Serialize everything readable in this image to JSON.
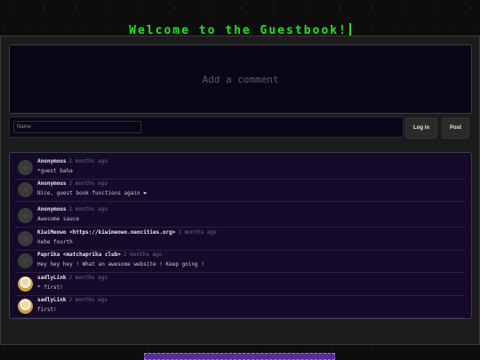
{
  "header": {
    "title": "Welcome to the Guestbook!"
  },
  "form": {
    "comment_placeholder": "Add a comment",
    "name_placeholder": "Name",
    "login_label": "Log in",
    "post_label": "Post"
  },
  "comments": [
    {
      "author": "Anonymous",
      "time": "2 months ago",
      "text": "*guest baha",
      "avatar": "default"
    },
    {
      "author": "Anonymous",
      "time": "2 months ago",
      "text": "Nice, guest book functions again ❤",
      "avatar": "default"
    },
    {
      "author": "Anonymous",
      "time": "2 months ago",
      "text": "Awesome sauce",
      "avatar": "default"
    },
    {
      "author": "KiwiMeowo <https://kiwimeowo.neocities.org>",
      "time": "2 months ago",
      "text": "hehe fourth",
      "avatar": "default"
    },
    {
      "author": "Paprika <matchaprika club>",
      "time": "2 months ago",
      "text": "Hey hey hey ! What an awesome website ! Keep going !",
      "avatar": "default"
    },
    {
      "author": "sadlyLink",
      "time": "2 months ago",
      "text": "* first!",
      "avatar": "image"
    },
    {
      "author": "sadlyLink",
      "time": "2 months ago",
      "text": "first!",
      "avatar": "image"
    }
  ],
  "colors": {
    "title": "#25e225",
    "panel": "#150a2a",
    "accent_bar": "#5b2b9a"
  },
  "icons": {
    "default_avatar": "user-avatar-icon"
  }
}
